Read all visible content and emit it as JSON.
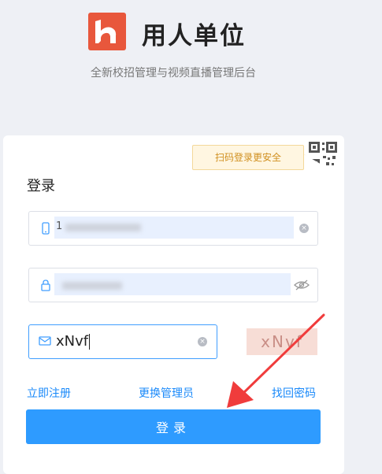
{
  "header": {
    "title": "用人单位",
    "subtitle": "全新校招管理与视频直播管理后台"
  },
  "login": {
    "qr_tip": "扫码登录更安全",
    "title": "登录",
    "phone_value": "1",
    "captcha_value": "xNvf",
    "captcha_image_text": "xNvf",
    "links": {
      "register": "立即注册",
      "change_admin": "更换管理员",
      "forgot_password": "找回密码"
    },
    "submit_label": "登录"
  },
  "colors": {
    "brand": "#e8573c",
    "primary": "#2e9bff",
    "link": "#1989fa",
    "annotation_arrow": "#f03c3c"
  }
}
